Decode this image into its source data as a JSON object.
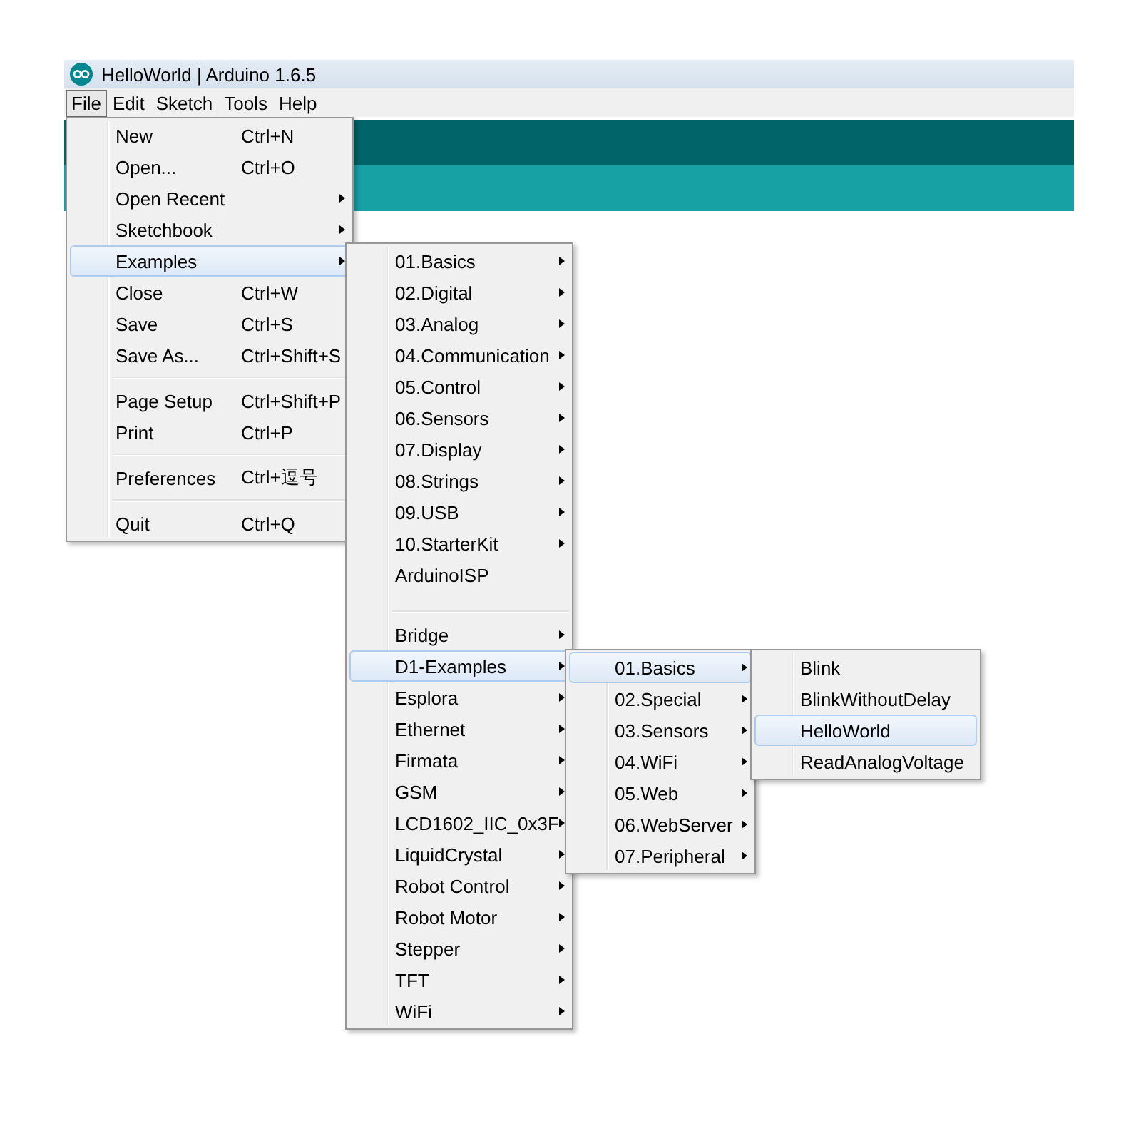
{
  "window": {
    "title": "HelloWorld | Arduino 1.6.5"
  },
  "menu_bar": [
    {
      "label": "File",
      "selected": true
    },
    {
      "label": "Edit",
      "selected": false
    },
    {
      "label": "Sketch",
      "selected": false
    },
    {
      "label": "Tools",
      "selected": false
    },
    {
      "label": "Help",
      "selected": false
    }
  ],
  "file_menu": {
    "items": [
      {
        "kind": "item",
        "label": "New",
        "shortcut": "Ctrl+N",
        "submenu": false,
        "selected": false
      },
      {
        "kind": "item",
        "label": "Open...",
        "shortcut": "Ctrl+O",
        "submenu": false,
        "selected": false
      },
      {
        "kind": "item",
        "label": "Open Recent",
        "submenu": true,
        "selected": false
      },
      {
        "kind": "item",
        "label": "Sketchbook",
        "submenu": true,
        "selected": false
      },
      {
        "kind": "item",
        "label": "Examples",
        "submenu": true,
        "selected": true
      },
      {
        "kind": "item",
        "label": "Close",
        "shortcut": "Ctrl+W",
        "submenu": false,
        "selected": false
      },
      {
        "kind": "item",
        "label": "Save",
        "shortcut": "Ctrl+S",
        "submenu": false,
        "selected": false
      },
      {
        "kind": "item",
        "label": "Save As...",
        "shortcut": "Ctrl+Shift+S",
        "submenu": false,
        "selected": false
      },
      {
        "kind": "separator"
      },
      {
        "kind": "item",
        "label": "Page Setup",
        "shortcut": "Ctrl+Shift+P",
        "submenu": false,
        "selected": false
      },
      {
        "kind": "item",
        "label": "Print",
        "shortcut": "Ctrl+P",
        "submenu": false,
        "selected": false
      },
      {
        "kind": "separator"
      },
      {
        "kind": "item",
        "label": "Preferences",
        "shortcut": "Ctrl+逗号",
        "submenu": false,
        "selected": false
      },
      {
        "kind": "separator"
      },
      {
        "kind": "item",
        "label": "Quit",
        "shortcut": "Ctrl+Q",
        "submenu": false,
        "selected": false
      }
    ]
  },
  "examples_menu": {
    "items": [
      {
        "kind": "item",
        "label": "01.Basics",
        "submenu": true,
        "selected": false
      },
      {
        "kind": "item",
        "label": "02.Digital",
        "submenu": true,
        "selected": false
      },
      {
        "kind": "item",
        "label": "03.Analog",
        "submenu": true,
        "selected": false
      },
      {
        "kind": "item",
        "label": "04.Communication",
        "submenu": true,
        "selected": false
      },
      {
        "kind": "item",
        "label": "05.Control",
        "submenu": true,
        "selected": false
      },
      {
        "kind": "item",
        "label": "06.Sensors",
        "submenu": true,
        "selected": false
      },
      {
        "kind": "item",
        "label": "07.Display",
        "submenu": true,
        "selected": false
      },
      {
        "kind": "item",
        "label": "08.Strings",
        "submenu": true,
        "selected": false
      },
      {
        "kind": "item",
        "label": "09.USB",
        "submenu": true,
        "selected": false
      },
      {
        "kind": "item",
        "label": "10.StarterKit",
        "submenu": true,
        "selected": false
      },
      {
        "kind": "item",
        "label": "ArduinoISP",
        "submenu": false,
        "selected": false
      },
      {
        "kind": "separator"
      },
      {
        "kind": "item",
        "label": "Bridge",
        "submenu": true,
        "selected": false
      },
      {
        "kind": "item",
        "label": "D1-Examples",
        "submenu": true,
        "selected": true
      },
      {
        "kind": "item",
        "label": "Esplora",
        "submenu": true,
        "selected": false
      },
      {
        "kind": "item",
        "label": "Ethernet",
        "submenu": true,
        "selected": false
      },
      {
        "kind": "item",
        "label": "Firmata",
        "submenu": true,
        "selected": false
      },
      {
        "kind": "item",
        "label": "GSM",
        "submenu": true,
        "selected": false
      },
      {
        "kind": "item",
        "label": "LCD1602_IIC_0x3F",
        "submenu": true,
        "selected": false
      },
      {
        "kind": "item",
        "label": "LiquidCrystal",
        "submenu": true,
        "selected": false
      },
      {
        "kind": "item",
        "label": "Robot Control",
        "submenu": true,
        "selected": false
      },
      {
        "kind": "item",
        "label": "Robot Motor",
        "submenu": true,
        "selected": false
      },
      {
        "kind": "item",
        "label": "Stepper",
        "submenu": true,
        "selected": false
      },
      {
        "kind": "item",
        "label": "TFT",
        "submenu": true,
        "selected": false
      },
      {
        "kind": "item",
        "label": "WiFi",
        "submenu": true,
        "selected": false
      }
    ]
  },
  "d1_examples_menu": {
    "items": [
      {
        "kind": "item",
        "label": "01.Basics",
        "submenu": true,
        "selected": true
      },
      {
        "kind": "item",
        "label": "02.Special",
        "submenu": true,
        "selected": false
      },
      {
        "kind": "item",
        "label": "03.Sensors",
        "submenu": true,
        "selected": false
      },
      {
        "kind": "item",
        "label": "04.WiFi",
        "submenu": true,
        "selected": false
      },
      {
        "kind": "item",
        "label": "05.Web",
        "submenu": true,
        "selected": false
      },
      {
        "kind": "item",
        "label": "06.WebServer",
        "submenu": true,
        "selected": false
      },
      {
        "kind": "item",
        "label": "07.Peripheral",
        "submenu": true,
        "selected": false
      }
    ]
  },
  "basics_menu": {
    "items": [
      {
        "kind": "item",
        "label": "Blink",
        "submenu": false,
        "selected": false
      },
      {
        "kind": "item",
        "label": "BlinkWithoutDelay",
        "submenu": false,
        "selected": false
      },
      {
        "kind": "item",
        "label": "HelloWorld",
        "submenu": false,
        "selected": true
      },
      {
        "kind": "item",
        "label": "ReadAnalogVoltage",
        "submenu": false,
        "selected": false
      }
    ]
  }
}
